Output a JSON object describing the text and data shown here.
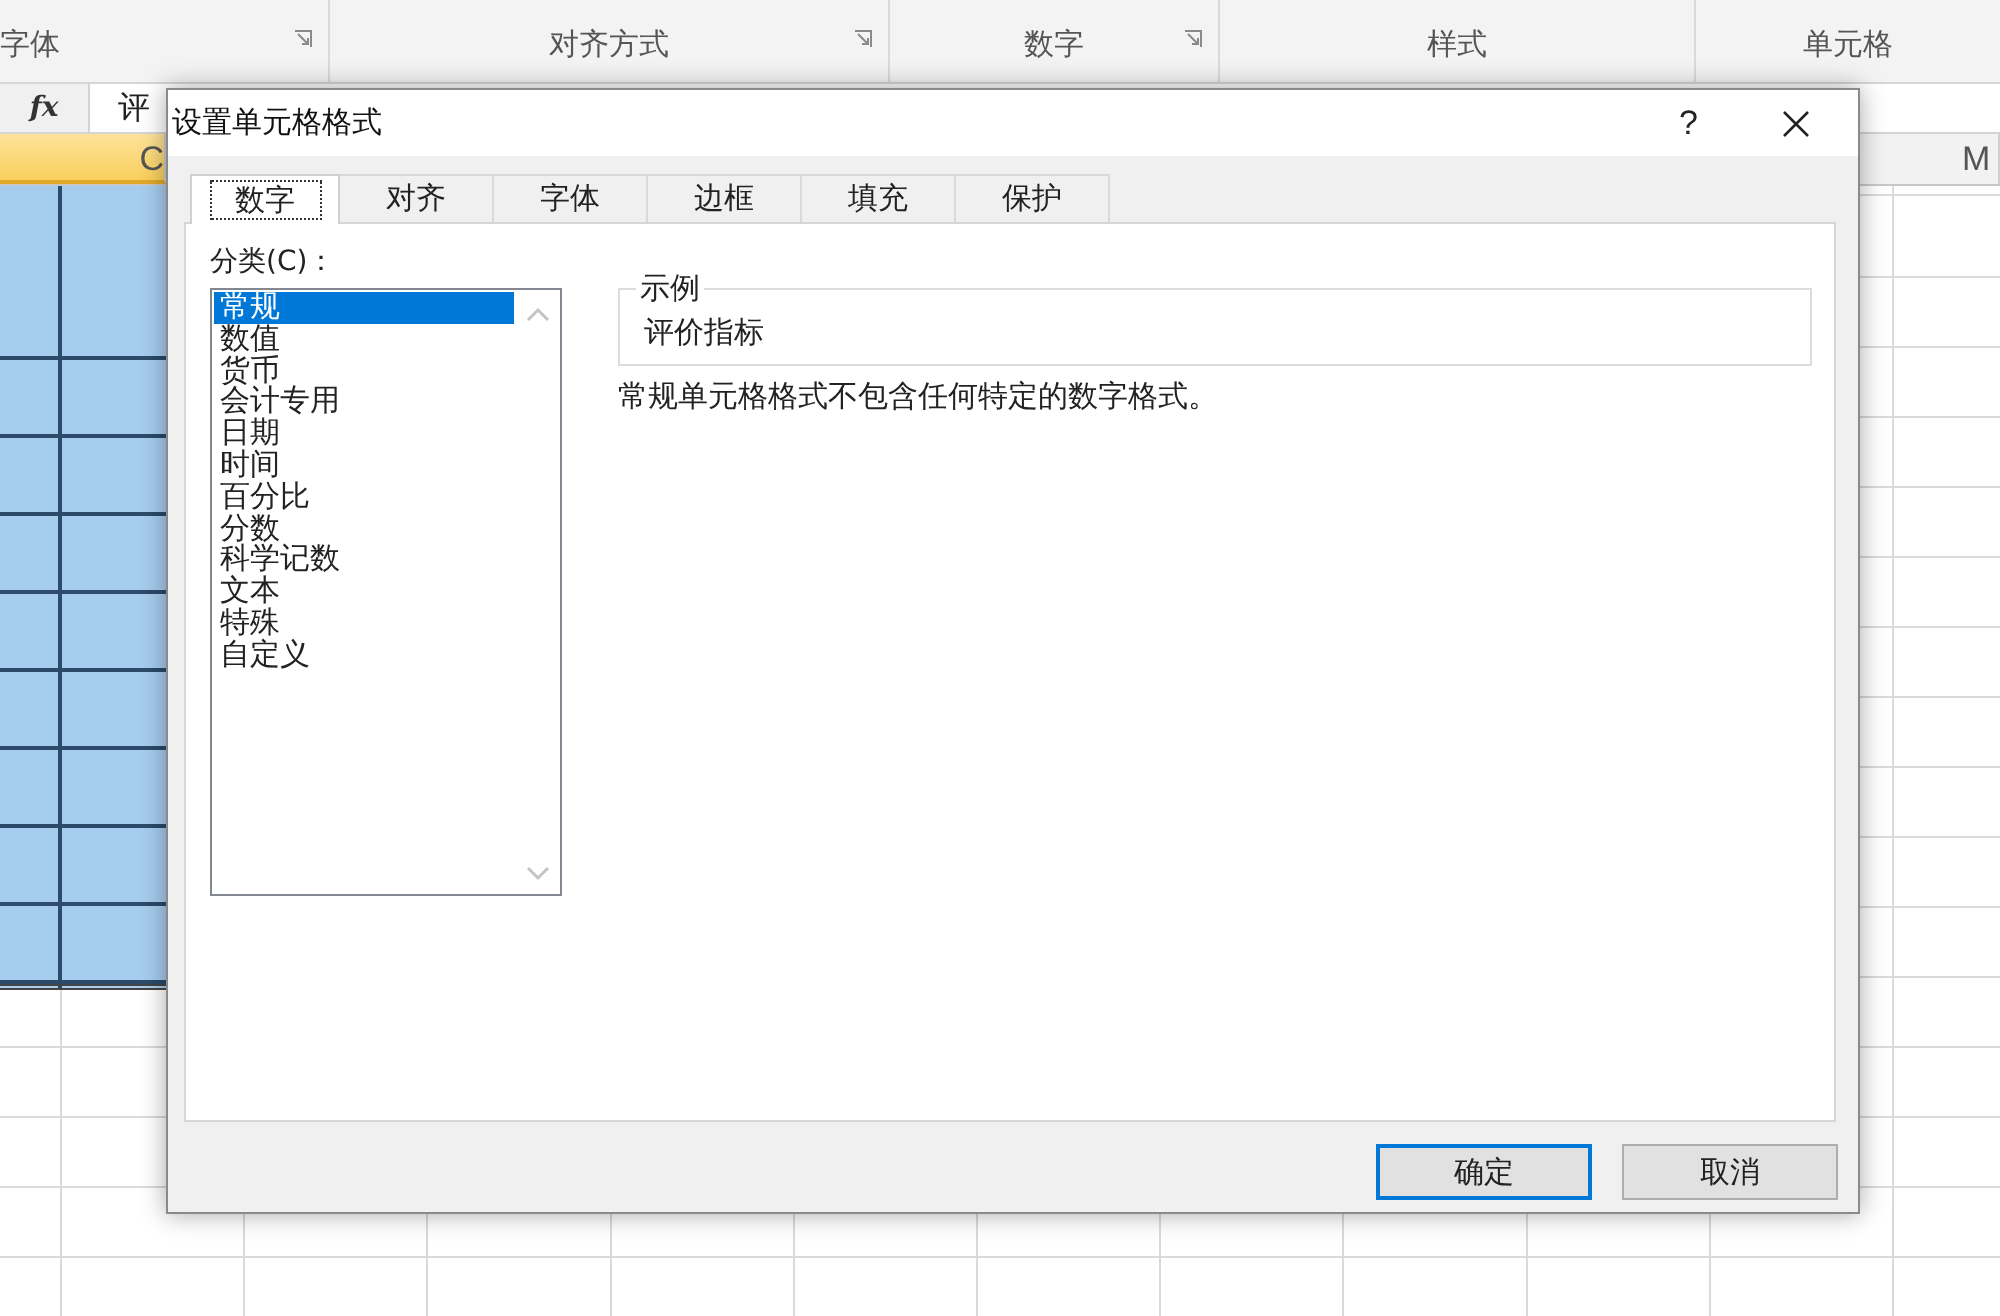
{
  "ribbon": {
    "groups": [
      {
        "label": "字体",
        "launcher": true
      },
      {
        "label": "对齐方式",
        "launcher": true
      },
      {
        "label": "数字",
        "launcher": true
      },
      {
        "label": "样式",
        "launcher": false
      },
      {
        "label": "单元格",
        "launcher": false
      }
    ]
  },
  "formula_bar": {
    "function_label": "fx",
    "value": "评"
  },
  "column_headers": [
    {
      "label": "C",
      "selected": true
    },
    {
      "label": "M",
      "selected": false
    }
  ],
  "dialog": {
    "title": "设置单元格格式",
    "help": "?",
    "tabs": [
      {
        "label": "数字",
        "selected": true
      },
      {
        "label": "对齐",
        "selected": false
      },
      {
        "label": "字体",
        "selected": false
      },
      {
        "label": "边框",
        "selected": false
      },
      {
        "label": "填充",
        "selected": false
      },
      {
        "label": "保护",
        "selected": false
      }
    ],
    "category_label": "分类(C)：",
    "categories": [
      {
        "label": "常规",
        "selected": true
      },
      {
        "label": "数值",
        "selected": false
      },
      {
        "label": "货币",
        "selected": false
      },
      {
        "label": "会计专用",
        "selected": false
      },
      {
        "label": "日期",
        "selected": false
      },
      {
        "label": "时间",
        "selected": false
      },
      {
        "label": "百分比",
        "selected": false
      },
      {
        "label": "分数",
        "selected": false
      },
      {
        "label": "科学记数",
        "selected": false
      },
      {
        "label": "文本",
        "selected": false
      },
      {
        "label": "特殊",
        "selected": false
      },
      {
        "label": "自定义",
        "selected": false
      }
    ],
    "sample": {
      "legend": "示例",
      "value": "评价指标"
    },
    "description": "常规单元格格式不包含任何特定的数字格式。",
    "buttons": [
      {
        "label": "确定",
        "default": true
      },
      {
        "label": "取消",
        "default": false
      }
    ]
  }
}
